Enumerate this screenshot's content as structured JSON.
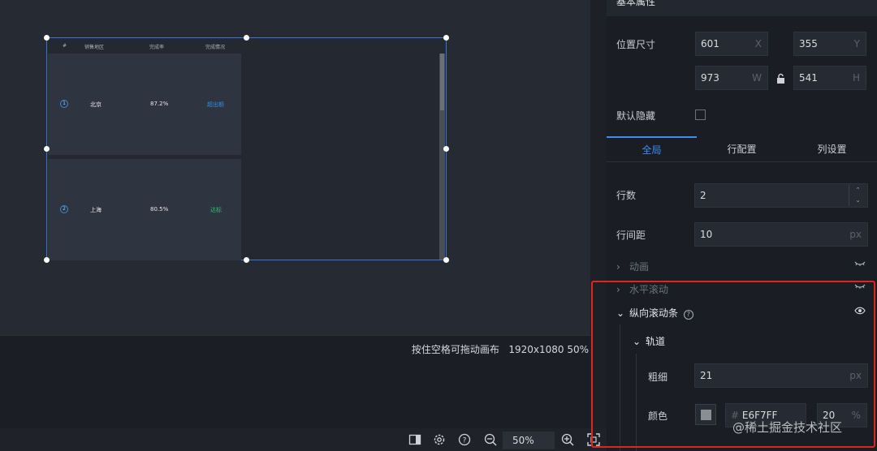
{
  "canvas": {
    "table": {
      "headers": [
        "#",
        "销售地区",
        "完成率",
        "完成情况"
      ],
      "rows": [
        {
          "index": "1",
          "region": "北京",
          "rate": "87.2%",
          "status": "超出额",
          "status_color": "#2f8ee8"
        },
        {
          "index": "2",
          "region": "上海",
          "rate": "80.5%",
          "status": "达标",
          "status_color": "#2fc26b"
        }
      ]
    }
  },
  "status_bar": {
    "hint": "按住空格可拖动画布",
    "resolution": "1920x1080",
    "zoom": "50%"
  },
  "toolbar": {
    "zoom_value": "50%"
  },
  "panel": {
    "header": "基本属性",
    "position_size_label": "位置尺寸",
    "x_value": "601",
    "x_suffix": "X",
    "y_value": "355",
    "y_suffix": "Y",
    "w_value": "973",
    "w_suffix": "W",
    "h_value": "541",
    "h_suffix": "H",
    "default_hidden_label": "默认隐藏",
    "tabs": [
      "全局",
      "行配置",
      "列设置"
    ],
    "rows_label": "行数",
    "rows_value": "2",
    "row_gap_label": "行间距",
    "row_gap_value": "10",
    "row_gap_suffix": "px",
    "animation_label": "动画",
    "h_scroll_label": "水平滚动",
    "v_scrollbar_label": "纵向滚动条",
    "track_label": "轨道",
    "thickness_label": "粗细",
    "thickness_value": "21",
    "thickness_suffix": "px",
    "color_label": "颜色",
    "color_hash": "#",
    "color_value": "E6F7FF",
    "opacity_value": "20",
    "opacity_suffix": "%"
  },
  "watermark": "@稀土掘金技术社区",
  "colors": {
    "accent": "#3d8ef0",
    "highlight_border": "#e0251f"
  }
}
